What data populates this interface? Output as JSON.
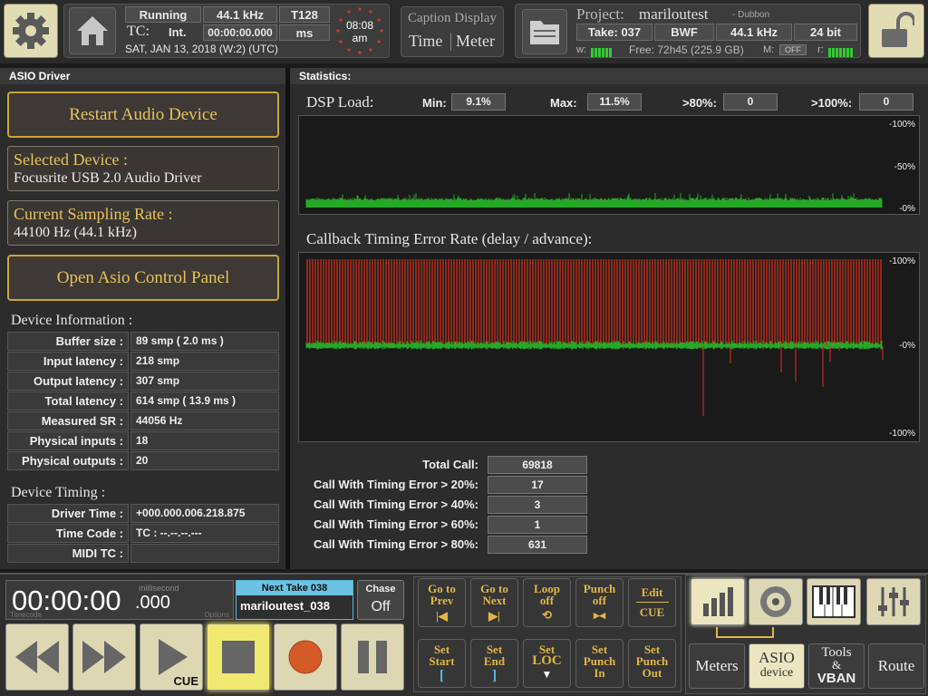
{
  "header": {
    "settings_icon": "gear-icon",
    "home_icon": "home-icon",
    "status": "Running",
    "sample_rate": "44.1 kHz",
    "tempo": "T128",
    "tc_label": "TC:",
    "tc_mode": "Int.",
    "timecode": "00:00:00.000",
    "tc_unit": "ms",
    "date_line": "SAT, JAN 13, 2018 (W:2) (UTC)",
    "clock_time": "08:08",
    "clock_ampm": "am",
    "caption_title": "Caption Display",
    "caption_time": "Time",
    "caption_meter": "Meter",
    "project_label": "Project:",
    "project_name": "mariloutest",
    "project_sub": "- Dubbon",
    "take": "Take: 037",
    "format": "BWF",
    "project_rate": "44.1 kHz",
    "bit_depth": "24 bit",
    "w_label": "w:",
    "free_space": "Free: 72h45 (225.9 GB)",
    "m_label": "M:",
    "m_value": "OFF",
    "r_label": "r:",
    "lock_icon": "unlock-icon"
  },
  "left_panel": {
    "header": "ASIO Driver",
    "restart_button": "Restart Audio Device",
    "selected_device_title": "Selected Device :",
    "selected_device_value": "Focusrite USB 2.0 Audio Driver",
    "sampling_rate_title": "Current Sampling Rate :",
    "sampling_rate_value": "44100 Hz (44.1 kHz)",
    "asio_panel_button": "Open Asio Control Panel",
    "device_info_title": "Device Information :",
    "device_info": [
      {
        "label": "Buffer size :",
        "value": "89 smp ( 2.0 ms )"
      },
      {
        "label": "Input latency :",
        "value": "218 smp"
      },
      {
        "label": "Output latency :",
        "value": "307 smp"
      },
      {
        "label": "Total latency :",
        "value": "614 smp ( 13.9 ms )"
      },
      {
        "label": "Measured SR :",
        "value": "44056 Hz"
      },
      {
        "label": "Physical inputs :",
        "value": "18"
      },
      {
        "label": "Physical outputs :",
        "value": "20"
      }
    ],
    "device_timing_title": "Device Timing :",
    "device_timing": [
      {
        "label": "Driver Time :",
        "value": "+000.000.006.218.875"
      },
      {
        "label": "Time Code :",
        "value": "TC : --.--.--.---"
      },
      {
        "label": "MIDI TC :",
        "value": ""
      }
    ]
  },
  "statistics": {
    "header": "Statistics:",
    "dsp_title": "DSP Load:",
    "min_label": "Min:",
    "min_value": "9.1%",
    "max_label": "Max:",
    "max_value": "11.5%",
    "over80_label": ">80%:",
    "over80_value": "0",
    "over100_label": ">100%:",
    "over100_value": "0",
    "dsp_ticks": [
      "-100%",
      "-50%",
      "-0%"
    ],
    "callback_title": "Callback Timing Error Rate (delay / advance):",
    "callback_ticks": [
      "-100%",
      "-0%",
      "-100%"
    ],
    "totals": [
      {
        "label": "Total Call:",
        "value": "69818"
      },
      {
        "label": "Call With Timing Error > 20%:",
        "value": "17"
      },
      {
        "label": "Call With Timing Error > 40%:",
        "value": "3"
      },
      {
        "label": "Call With Timing Error > 60%:",
        "value": "1"
      },
      {
        "label": "Call With Timing Error > 80%:",
        "value": "631"
      }
    ]
  },
  "transport": {
    "counter": "00:00:00",
    "counter_ms": ".000",
    "counter_unit": "millisecond",
    "counter_sub_left": "Timecode",
    "counter_sub_right": "Options",
    "next_take_label": "Next Take 038",
    "next_take_name": "mariloutest_038",
    "chase_label": "Chase",
    "chase_value": "Off",
    "cue_label": "CUE",
    "nav_buttons": [
      {
        "line1": "Go to",
        "line2": "Prev",
        "glyph": "|◀"
      },
      {
        "line1": "Go to",
        "line2": "Next",
        "glyph": "▶|"
      },
      {
        "line1": "Loop",
        "line2": "off",
        "glyph": "⟲"
      },
      {
        "line1": "Punch",
        "line2": "off",
        "glyph": "▸◂"
      },
      {
        "line1": "Edit",
        "line2": "CUE",
        "glyph": ""
      }
    ],
    "set_buttons": [
      {
        "line1": "Set",
        "line2": "Start",
        "glyph": "["
      },
      {
        "line1": "Set",
        "line2": "End",
        "glyph": "]"
      },
      {
        "line1": "Set",
        "line2": "LOC",
        "glyph": "▼"
      },
      {
        "line1": "Set",
        "line2": "Punch",
        "line3": "In"
      },
      {
        "line1": "Set",
        "line2": "Punch",
        "line3": "Out"
      }
    ],
    "mode_buttons": [
      {
        "label": "Meters"
      },
      {
        "label1": "ASIO",
        "label2": "device"
      },
      {
        "label1": "Tools",
        "label2": "&",
        "label3": "VBAN"
      },
      {
        "label": "Route"
      }
    ]
  },
  "colors": {
    "gold": "#e8c25a",
    "dsp_green": "#28a828",
    "error_red": "#c0301c",
    "button_cream": "#ddd7b4",
    "record_orange": "#d45a28",
    "stop_yellow": "#f0e870"
  }
}
